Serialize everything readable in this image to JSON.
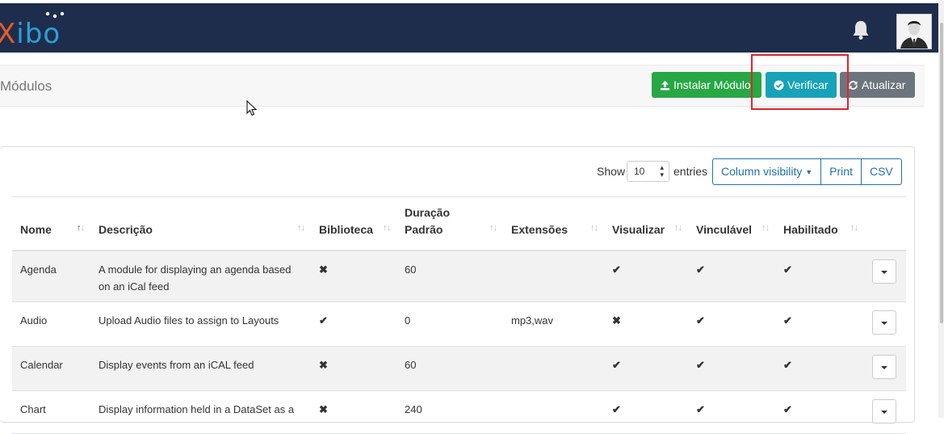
{
  "brand": {
    "logo_x": "X",
    "logo_rest": "ibo",
    "logo_dots_color": "#ffffff"
  },
  "topbar": {
    "notification_icon": "bell-icon",
    "user_icon": "user-avatar"
  },
  "header": {
    "title": "Módulos",
    "install_label": "Instalar Módulo",
    "check_label": "Verificar",
    "refresh_label": "Atualizar"
  },
  "table_controls": {
    "show_label": "Show",
    "page_length": "10",
    "entries_label": "entries",
    "column_visibility_label": "Column visibility",
    "print_label": "Print",
    "csv_label": "CSV"
  },
  "table": {
    "headers": {
      "nome": "Nome",
      "descricao": "Descrição",
      "biblioteca": "Biblioteca",
      "duracao_1": "Duração",
      "duracao_2": "Padrão",
      "extensoes": "Extensões",
      "visualizar": "Visualizar",
      "vinculavel": "Vinculável",
      "habilitado": "Habilitado"
    },
    "rows": [
      {
        "nome": "Agenda",
        "descricao": "A module for displaying an agenda based on an iCal feed",
        "biblioteca": "✖",
        "duracao": "60",
        "extensoes": "",
        "visualizar": "✔",
        "vinculavel": "✔",
        "habilitado": "✔"
      },
      {
        "nome": "Audio",
        "descricao": "Upload Audio files to assign to Layouts",
        "biblioteca": "✔",
        "duracao": "0",
        "extensoes": "mp3,wav",
        "visualizar": "✖",
        "vinculavel": "✔",
        "habilitado": "✔"
      },
      {
        "nome": "Calendar",
        "descricao": "Display events from an iCAL feed",
        "biblioteca": "✖",
        "duracao": "60",
        "extensoes": "",
        "visualizar": "✔",
        "vinculavel": "✔",
        "habilitado": "✔"
      },
      {
        "nome": "Chart",
        "descricao": "Display information held in a DataSet as a",
        "biblioteca": "✖",
        "duracao": "240",
        "extensoes": "",
        "visualizar": "✔",
        "vinculavel": "✔",
        "habilitado": "✔"
      }
    ]
  },
  "colors": {
    "topbar": "#1f2d4d",
    "success": "#28a745",
    "info": "#17a2b8",
    "secondary": "#6c757d",
    "highlight": "#e0242b",
    "link": "#2271b1"
  }
}
